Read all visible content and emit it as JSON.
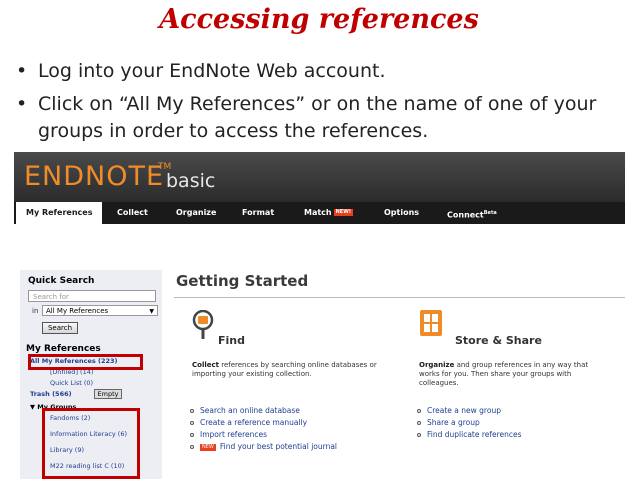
{
  "slide": {
    "title": "Accessing references",
    "bullets": [
      "Log into your EndNote Web account.",
      "Click on “All My References” or on the name of one of your groups in order to access the references."
    ]
  },
  "app": {
    "brand": "ENDNOTE",
    "brand_tm": "TM",
    "brand_suffix": "basic",
    "tabs": [
      {
        "label": "My References",
        "active": true
      },
      {
        "label": "Collect"
      },
      {
        "label": "Organize"
      },
      {
        "label": "Format"
      },
      {
        "label": "Match",
        "badge": "NEW!"
      },
      {
        "label": "Options"
      },
      {
        "label": "Connect",
        "sup": "Beta"
      }
    ]
  },
  "sidebar": {
    "quick_search_title": "Quick Search",
    "search_placeholder": "Search for",
    "in_label": "in",
    "in_value": "All My References",
    "search_button": "Search",
    "my_references_title": "My References",
    "all_refs": "All My References (223)",
    "unfiled": "[Unfiled] (14)",
    "quick_list": "Quick List (0)",
    "trash": "Trash (566)",
    "empty_button": "Empty",
    "my_groups": "My Groups",
    "groups": [
      "Fandoms (2)",
      "Information Literacy (6)",
      "Library (9)",
      "M22 reading list C (10)"
    ]
  },
  "main": {
    "heading": "Getting Started",
    "find": {
      "title": "Find",
      "lead": "Collect",
      "desc": " references by searching online databases or importing your existing collection.",
      "links": [
        "Search an online database",
        "Create a reference manually",
        "Import references",
        "Find your best potential journal"
      ],
      "new_badge": "NEW"
    },
    "store": {
      "title": "Store & Share",
      "lead": "Organize",
      "desc": " and group references in any way that works for you. Then share your groups with colleagues.",
      "links": [
        "Create a new group",
        "Share a group",
        "Find duplicate references"
      ]
    }
  },
  "colors": {
    "title_red": "#c00000",
    "brand_orange": "#f08c28",
    "link_blue": "#1f3f8f",
    "highlight": "#c00000"
  }
}
